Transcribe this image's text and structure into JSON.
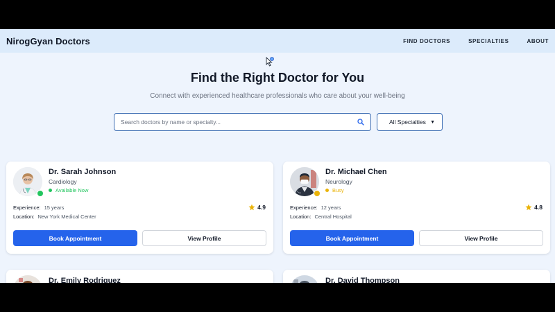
{
  "navbar": {
    "brand": "NirogGyan Doctors",
    "links": [
      "FIND DOCTORS",
      "SPECIALTIES",
      "ABOUT"
    ]
  },
  "hero": {
    "title": "Find the Right Doctor for You",
    "subtitle": "Connect with experienced healthcare professionals who care about your well-being"
  },
  "search": {
    "placeholder": "Search doctors by name or specialty...",
    "icon": "search-icon"
  },
  "filter": {
    "selected": "All Specialties",
    "arrow": "▼"
  },
  "labels": {
    "experience": "Experience:",
    "location": "Location:",
    "book": "Book Appointment",
    "view": "View Profile"
  },
  "doctors": [
    {
      "name": "Dr. Sarah Johnson",
      "specialty": "Cardiology",
      "status": "Available Now",
      "status_color": "#22c55e",
      "experience": "15 years",
      "location": "New York Medical Center",
      "rating": "4.9"
    },
    {
      "name": "Dr. Michael Chen",
      "specialty": "Neurology",
      "status": "Busy",
      "status_color": "#eab308",
      "experience": "12 years",
      "location": "Central Hospital",
      "rating": "4.8"
    },
    {
      "name": "Dr. Emily Rodriguez"
    },
    {
      "name": "Dr. David Thompson"
    }
  ],
  "colors": {
    "primary": "#2563eb",
    "available": "#22c55e",
    "busy": "#eab308",
    "star": "#eab308"
  }
}
